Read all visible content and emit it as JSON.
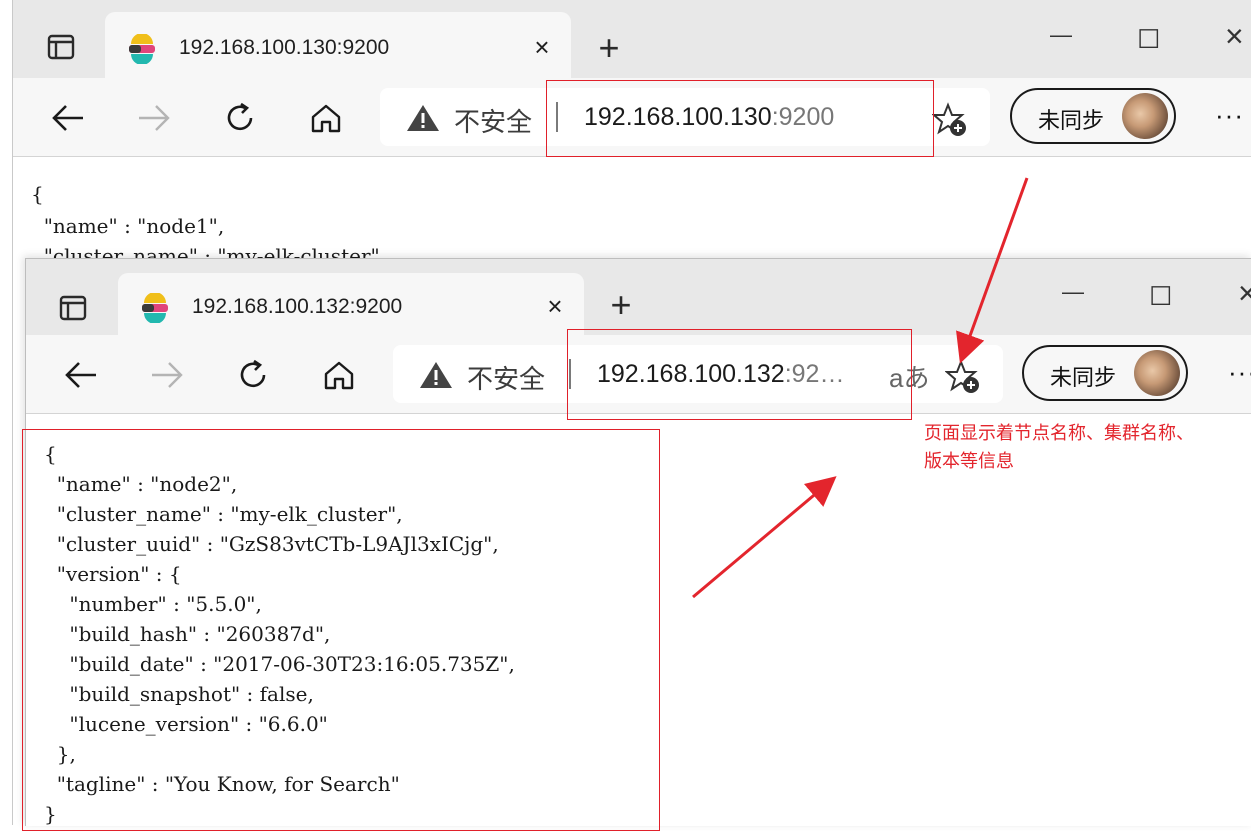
{
  "back_window": {
    "tab_title": "192.168.100.130:9200",
    "security_label": "不安全",
    "url_host": "192.168.100.130",
    "url_port": ":9200",
    "sync_label": "未同步",
    "json_lines": [
      "{",
      "  \"name\" : \"node1\",",
      "  \"cluster_name\" : \"my-elk-cluster\","
    ]
  },
  "front_window": {
    "tab_title": "192.168.100.132:9200",
    "security_label": "不安全",
    "url_host": "192.168.100.132",
    "url_port": ":92…",
    "read_aloud_label": "aあ",
    "sync_label": "未同步",
    "json_lines": [
      "{",
      "  \"name\" : \"node2\",",
      "  \"cluster_name\" : \"my-elk_cluster\",",
      "  \"cluster_uuid\" : \"GzS83vtCTb-L9AJl3xICjg\",",
      "  \"version\" : {",
      "    \"number\" : \"5.5.0\",",
      "    \"build_hash\" : \"260387d\",",
      "    \"build_date\" : \"2017-06-30T23:16:05.735Z\",",
      "    \"build_snapshot\" : false,",
      "    \"lucene_version\" : \"6.6.0\"",
      "  },",
      "  \"tagline\" : \"You Know, for Search\"",
      "}"
    ]
  },
  "annotation": {
    "line1": "页面显示着节点名称、集群名称、",
    "line2": "版本等信息",
    "color": "#e3252d"
  },
  "icons": {
    "close": "×",
    "new_tab": "+",
    "minimize": "—",
    "maximize": "☐",
    "more": "···"
  }
}
